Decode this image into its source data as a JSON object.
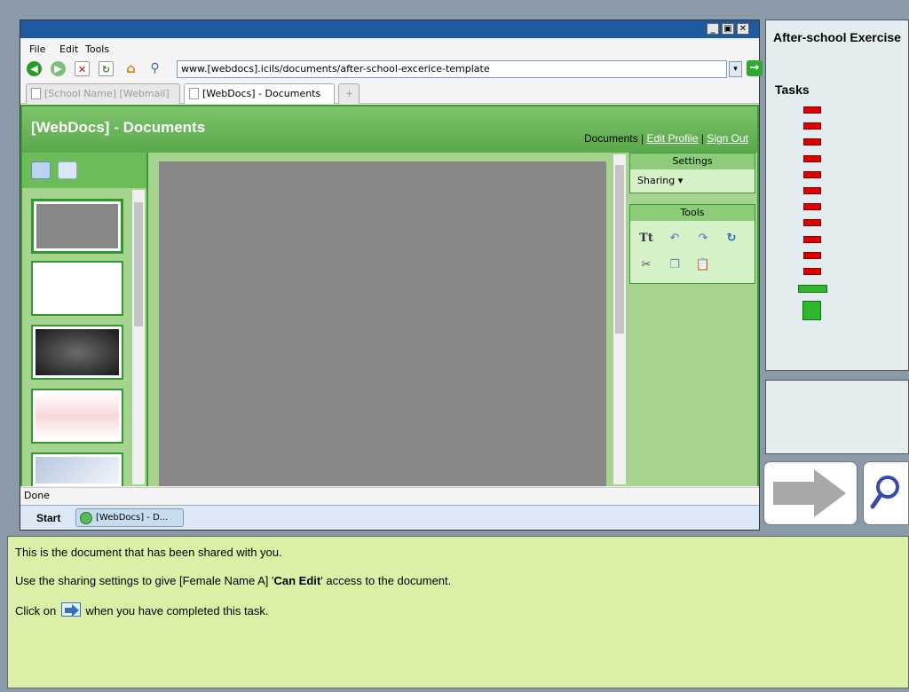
{
  "browser": {
    "window_buttons": {
      "minimize": "_",
      "maximize": "▣",
      "close": "✕"
    },
    "menu": [
      "File",
      "Edit",
      "Tools"
    ],
    "url": "www.[webdocs].icils/documents/after-school-excerice-template",
    "tabs": [
      {
        "label": "[School Name] [Webmail]",
        "active": false
      },
      {
        "label": "[WebDocs] - Documents",
        "active": true
      },
      {
        "label": "+",
        "active": false
      }
    ],
    "status": "Done"
  },
  "app": {
    "title": "[WebDocs] - Documents",
    "links": {
      "documents": "Documents",
      "edit_profile": "Edit Profile",
      "sign_out": "Sign Out",
      "separator": "|"
    },
    "settings": {
      "header": "Settings",
      "sharing_label": "Sharing ▾"
    },
    "tools": {
      "header": "Tools"
    }
  },
  "taskbar": {
    "start": "Start",
    "item": "[WebDocs] - D..."
  },
  "side": {
    "title": "After-school Exercise",
    "tasks_label": "Tasks",
    "completed_tasks": 11,
    "colors": {
      "done": "#dd0000",
      "current": "#2db82d"
    }
  },
  "instructions": {
    "line1": "This is the document that has been shared with you.",
    "line2_pre": "Use the sharing settings to give [Female Name A] '",
    "line2_bold": "Can Edit",
    "line2_post": "' access to the document.",
    "line3_pre": "Click on",
    "line3_post": "when you have completed this task."
  }
}
